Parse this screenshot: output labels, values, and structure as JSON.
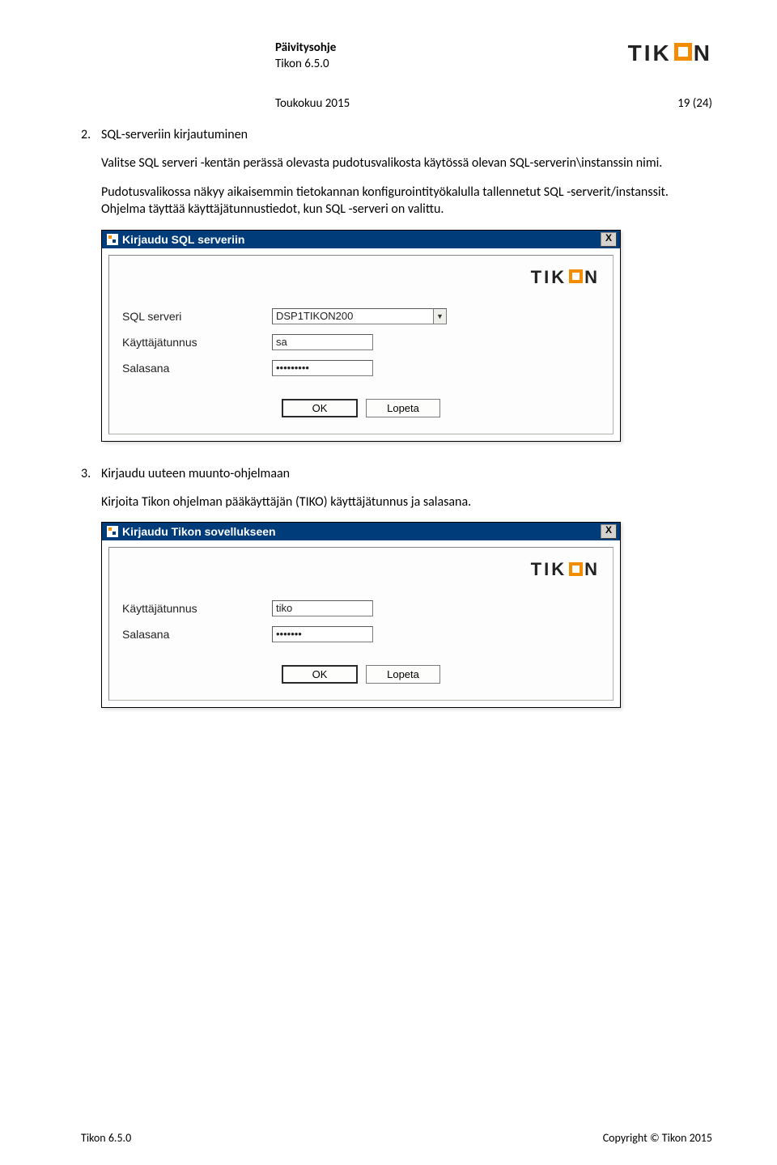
{
  "header": {
    "title_bold": "Päivitysohje",
    "title_sub": "Tikon 6.5.0"
  },
  "brand": {
    "t1": "TIK",
    "t2": "N"
  },
  "dateline": {
    "left": "Toukokuu 2015",
    "right": "19 (24)"
  },
  "section2": {
    "num": "2.",
    "title": "SQL-serveriin kirjautuminen",
    "p1": "Valitse SQL serveri -kentän perässä olevasta pudotusvalikosta käytössä olevan SQL-serverin\\instanssin nimi.",
    "p2": "Pudotusvalikossa näkyy aikaisemmin tietokannan konfigurointityökalulla tallennetut SQL -serverit/instanssit. Ohjelma täyttää käyttäjätunnustiedot, kun SQL -serveri on valittu."
  },
  "dialog1": {
    "title": "Kirjaudu SQL serveriin",
    "close": "X",
    "fields": {
      "server_label": "SQL serveri",
      "server_value": "DSP1TIKON200",
      "user_label": "Käyttäjätunnus",
      "user_value": "sa",
      "pass_label": "Salasana",
      "pass_value": "•••••••••"
    },
    "ok": "OK",
    "cancel": "Lopeta"
  },
  "section3": {
    "num": "3.",
    "title": "Kirjaudu uuteen muunto-ohjelmaan",
    "p1": "Kirjoita Tikon ohjelman pääkäyttäjän (TIKO) käyttäjätunnus ja salasana."
  },
  "dialog2": {
    "title": "Kirjaudu Tikon sovellukseen",
    "close": "X",
    "fields": {
      "user_label": "Käyttäjätunnus",
      "user_value": "tiko",
      "pass_label": "Salasana",
      "pass_value": "•••••••"
    },
    "ok": "OK",
    "cancel": "Lopeta"
  },
  "footer": {
    "left": "Tikon 6.5.0",
    "right": "Copyright © Tikon 2015"
  }
}
